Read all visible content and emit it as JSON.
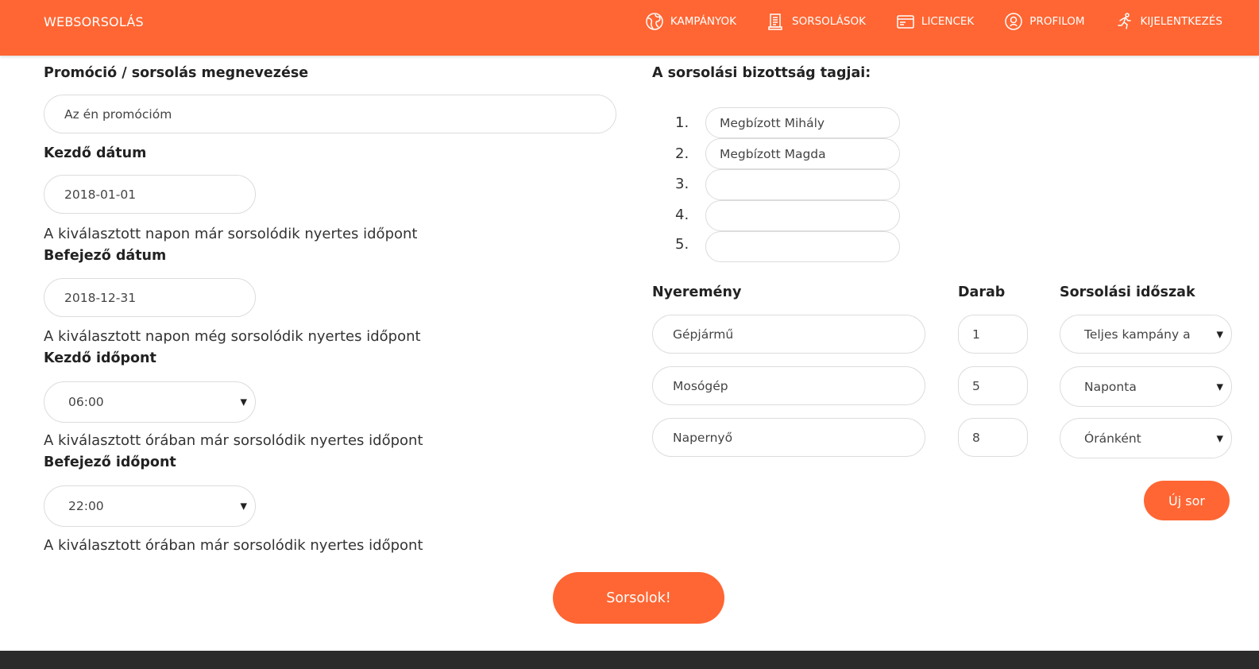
{
  "nav": {
    "brand": "WEBSORSOLÁS",
    "items": [
      {
        "label": "KAMPÁNYOK",
        "icon": "globe-icon"
      },
      {
        "label": "SORSOLÁSOK",
        "icon": "scroll-icon"
      },
      {
        "label": "LICENCEK",
        "icon": "card-icon"
      },
      {
        "label": "PROFILOM",
        "icon": "user-circle-icon"
      },
      {
        "label": "KIJELENTKEZÉS",
        "icon": "runner-icon"
      }
    ]
  },
  "form": {
    "promo_label": "Promóció / sorsolás megnevezése",
    "promo_value": "Az én promócióm",
    "start_date_label": "Kezdő dátum",
    "start_date_value": "2018-01-01",
    "start_date_hint": "A kiválasztott napon már sorsolódik nyertes időpont",
    "end_date_label": "Befejező dátum",
    "end_date_value": "2018-12-31",
    "end_date_hint": "A kiválasztott napon még sorsolódik nyertes időpont",
    "start_time_label": "Kezdő időpont",
    "start_time_value": "06:00",
    "start_time_hint": "A kiválasztott órában már sorsolódik nyertes időpont",
    "end_time_label": "Befejező időpont",
    "end_time_value": "22:00",
    "end_time_hint": "A kiválasztott órában már sorsolódik nyertes időpont"
  },
  "committee": {
    "title": "A sorsolási bizottság tagjai:",
    "members": [
      {
        "num": "1.",
        "name": "Megbízott Mihály"
      },
      {
        "num": "2.",
        "name": "Megbízott Magda"
      },
      {
        "num": "3.",
        "name": ""
      },
      {
        "num": "4.",
        "name": ""
      },
      {
        "num": "5.",
        "name": ""
      }
    ]
  },
  "prizes": {
    "col_prize": "Nyeremény",
    "col_count": "Darab",
    "col_period": "Sorsolási időszak",
    "rows": [
      {
        "prize": "Gépjármű",
        "count": "1",
        "period": "Teljes kampány a"
      },
      {
        "prize": "Mosógép",
        "count": "5",
        "period": "Naponta"
      },
      {
        "prize": "Napernyő",
        "count": "8",
        "period": "Óránként"
      }
    ],
    "new_row_label": "Új sor"
  },
  "submit_label": "Sorsolok!"
}
